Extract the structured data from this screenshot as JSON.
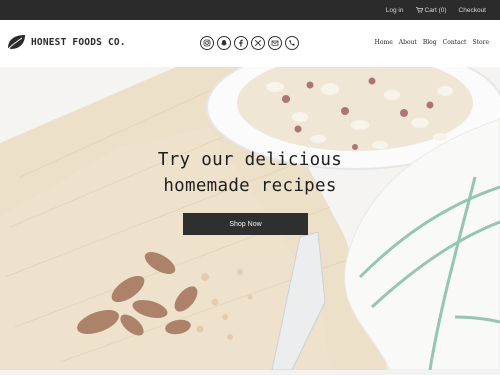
{
  "topbar": {
    "login": "Log in",
    "cart": "Cart (0)",
    "checkout": "Checkout",
    "cart_icon": "cart-icon"
  },
  "header": {
    "brand": "HONEST FOODS CO.",
    "logo_icon": "leaf-icon",
    "social_icons": [
      "instagram-icon",
      "snapchat-icon",
      "facebook-icon",
      "x-icon",
      "mail-icon",
      "phone-icon"
    ],
    "nav": [
      "Home",
      "About",
      "Blog",
      "Contact",
      "Store"
    ]
  },
  "hero": {
    "title_line1": "Try our delicious",
    "title_line2": "homemade recipes",
    "cta": "Shop Now"
  },
  "colors": {
    "topbar_bg": "#2b2b2b",
    "button_bg": "#2f2f2f",
    "text_dark": "#1f1f1f"
  }
}
